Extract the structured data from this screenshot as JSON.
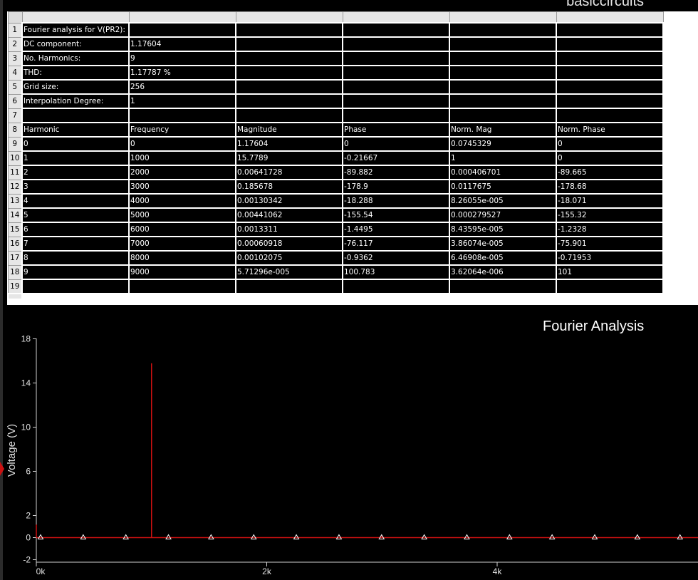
{
  "window": {
    "title_partial": "basiccircuits"
  },
  "spreadsheet": {
    "row_numbers": [
      "1",
      "2",
      "3",
      "4",
      "5",
      "6",
      "7",
      "8",
      "9",
      "10",
      "11",
      "12",
      "13",
      "14",
      "15",
      "16",
      "17",
      "18",
      "19"
    ],
    "rows": [
      [
        "Fourier analysis for V(PR2):",
        "",
        "",
        "",
        "",
        ""
      ],
      [
        "DC component:",
        "1.17604",
        "",
        "",
        "",
        ""
      ],
      [
        "No. Harmonics:",
        "9",
        "",
        "",
        "",
        ""
      ],
      [
        "THD:",
        "1.17787 %",
        "",
        "",
        "",
        ""
      ],
      [
        "Grid size:",
        "256",
        "",
        "",
        "",
        ""
      ],
      [
        "Interpolation Degree:",
        "1",
        "",
        "",
        "",
        ""
      ],
      [
        "",
        "",
        "",
        "",
        "",
        ""
      ],
      [
        "Harmonic",
        "Frequency",
        "Magnitude",
        "Phase",
        "Norm. Mag",
        "Norm. Phase"
      ],
      [
        "0",
        "0",
        "1.17604",
        "0",
        "0.0745329",
        "0"
      ],
      [
        "1",
        "1000",
        "15.7789",
        "-0.21667",
        "1",
        "0"
      ],
      [
        "2",
        "2000",
        "0.00641728",
        "-89.882",
        "0.000406701",
        "-89.665"
      ],
      [
        "3",
        "3000",
        "0.185678",
        "-178.9",
        "0.0117675",
        "-178.68"
      ],
      [
        "4",
        "4000",
        "0.00130342",
        "-18.288",
        "8.26055e-005",
        "-18.071"
      ],
      [
        "5",
        "5000",
        "0.00441062",
        "-155.54",
        "0.000279527",
        "-155.32"
      ],
      [
        "6",
        "6000",
        "0.0013311",
        "-1.4495",
        "8.43595e-005",
        "-1.2328"
      ],
      [
        "7",
        "7000",
        "0.00060918",
        "-76.117",
        "3.86074e-005",
        "-75.901"
      ],
      [
        "8",
        "8000",
        "0.00102075",
        "-0.9362",
        "6.46908e-005",
        "-0.71953"
      ],
      [
        "9",
        "9000",
        "5.71296e-005",
        "100.783",
        "3.62064e-006",
        "101"
      ],
      [
        "",
        "",
        "",
        "",
        "",
        ""
      ]
    ]
  },
  "chart_data": {
    "type": "bar",
    "title": "Fourier Analysis",
    "ylabel": "Voltage (V)",
    "xlabel": "",
    "ylim": [
      -3,
      18
    ],
    "xlim": [
      0,
      5800
    ],
    "yticks": [
      "18",
      "14",
      "10",
      "6",
      "2",
      "0",
      "-2"
    ],
    "ytick_values": [
      18,
      14,
      10,
      6,
      2,
      0,
      -2
    ],
    "xticks": [
      "0k",
      "2k",
      "4k"
    ],
    "xtick_values": [
      0,
      2000,
      4000
    ],
    "series": [
      {
        "x": [
          0,
          1000,
          2000,
          3000,
          4000,
          5000,
          6000,
          7000,
          8000,
          9000
        ],
        "values": [
          1.17604,
          15.7789,
          0.00641728,
          0.185678,
          0.00130342,
          0.00441062,
          0.0013311,
          0.00060918,
          0.00102075,
          5.71296e-05
        ]
      }
    ],
    "marker_step": 370,
    "marker_start": 37,
    "color": "#cc1111",
    "grid": false
  }
}
